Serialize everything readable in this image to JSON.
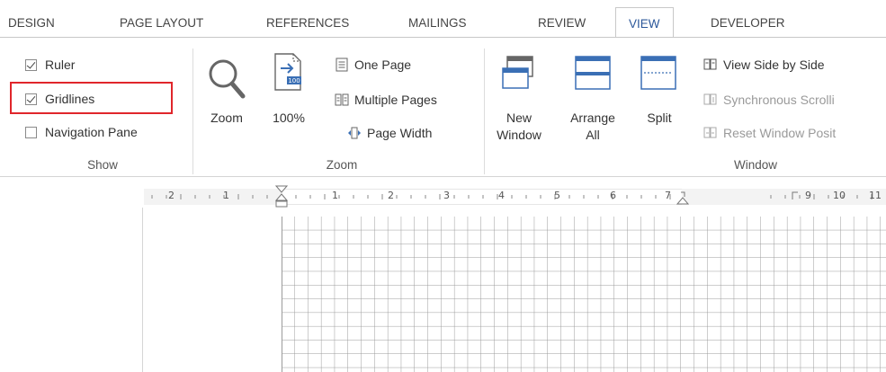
{
  "tabs": [
    {
      "label": "DESIGN",
      "active": false
    },
    {
      "label": "PAGE LAYOUT",
      "active": false
    },
    {
      "label": "REFERENCES",
      "active": false
    },
    {
      "label": "MAILINGS",
      "active": false
    },
    {
      "label": "REVIEW",
      "active": false
    },
    {
      "label": "VIEW",
      "active": true
    },
    {
      "label": "DEVELOPER",
      "active": false
    }
  ],
  "show_group": {
    "label": "Show",
    "ruler": {
      "label": "Ruler",
      "checked": true
    },
    "gridlines": {
      "label": "Gridlines",
      "checked": true
    },
    "navigation_pane": {
      "label": "Navigation Pane",
      "checked": false
    }
  },
  "zoom_group": {
    "label": "Zoom",
    "zoom_label": "Zoom",
    "hundred_label": "100%",
    "hundred_badge": "100",
    "one_page_label": "One Page",
    "multiple_pages_label": "Multiple Pages",
    "page_width_label": "Page Width"
  },
  "window_group": {
    "label": "Window",
    "new_window_line1": "New",
    "new_window_line2": "Window",
    "arrange_all_line1": "Arrange",
    "arrange_all_line2": "All",
    "split_label": "Split",
    "view_side_by_side_label": "View Side by Side",
    "synchronous_scrolling_label": "Synchronous Scrolli",
    "reset_window_position_label": "Reset Window Posit"
  },
  "ruler_numbers": {
    "n2l": "2",
    "n1l": "1",
    "n1": "1",
    "n2": "2",
    "n3": "3",
    "n4": "4",
    "n5": "5",
    "n6": "6",
    "n7": "7",
    "n9": "9",
    "n10": "10",
    "n11": "11"
  },
  "colors": {
    "accent": "#2b579a",
    "highlight": "#e0262b",
    "icon_blue": "#3a6fb5"
  }
}
